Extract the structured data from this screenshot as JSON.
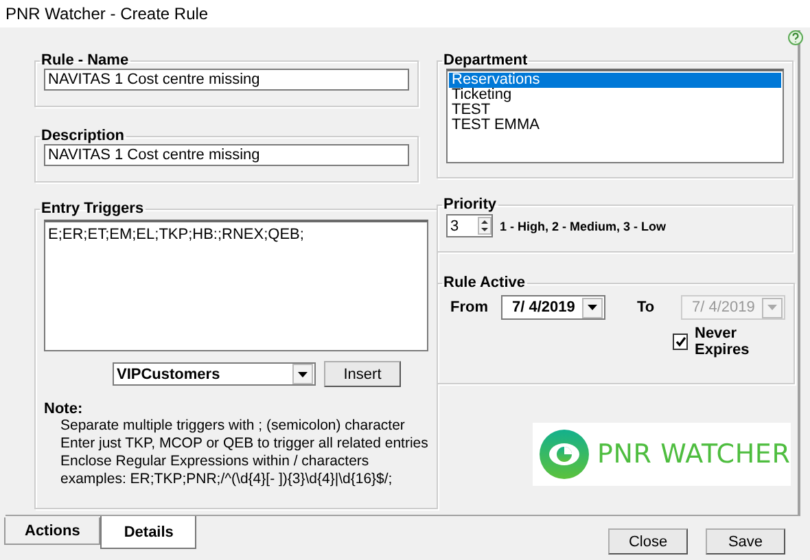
{
  "window": {
    "title": "PNR Watcher - Create Rule"
  },
  "rule_name": {
    "label": "Rule - Name",
    "value": "NAVITAS 1 Cost centre missing"
  },
  "description": {
    "label": "Description",
    "value": "NAVITAS 1 Cost centre missing"
  },
  "entry_triggers": {
    "label": "Entry Triggers",
    "value": "E;ER;ET;EM;EL;TKP;HB:;RNEX;QEB;",
    "dropdown": "VIPCustomers",
    "insert_button": "Insert",
    "note_title": "Note:",
    "note_lines": [
      "Separate multiple triggers with ; (semicolon) character",
      "Enter just TKP, MCOP or QEB to trigger all related entries",
      "Enclose Regular Expressions within / characters",
      "examples: ER;TKP;PNR;/^(\\d{4}[- ]){3}\\d{4}|\\d{16}$/;"
    ]
  },
  "department": {
    "label": "Department",
    "items": [
      {
        "label": "Reservations",
        "selected": true
      },
      {
        "label": "Ticketing",
        "selected": false
      },
      {
        "label": "TEST",
        "selected": false
      },
      {
        "label": "TEST EMMA",
        "selected": false
      }
    ]
  },
  "priority": {
    "label": "Priority",
    "value": "3",
    "hint": "1 - High, 2 - Medium, 3 - Low"
  },
  "rule_active": {
    "label": "Rule Active",
    "from_label": "From",
    "from_date": "7/ 4/2019",
    "to_label": "To",
    "to_date": "7/ 4/2019",
    "to_disabled": true,
    "never_expires": {
      "label": "Never Expires",
      "checked": true
    }
  },
  "logo": {
    "text": "PNR WATCHER"
  },
  "tabs": [
    {
      "label": "Actions",
      "selected": false
    },
    {
      "label": "Details",
      "selected": true
    }
  ],
  "buttons": [
    {
      "label": "Close"
    },
    {
      "label": "Save"
    }
  ]
}
